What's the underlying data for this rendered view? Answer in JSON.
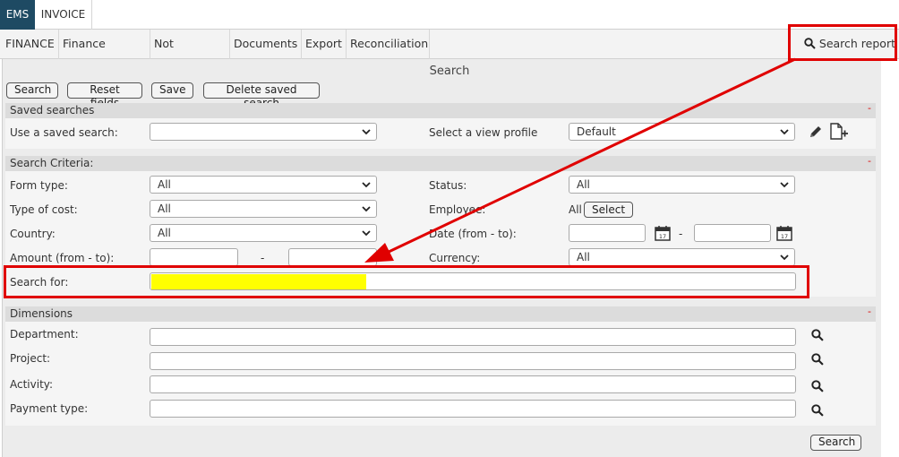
{
  "tabs": {
    "active": "EMS",
    "inactive": "INVOICE"
  },
  "nav": {
    "items": [
      "FINANCE",
      "Finance control",
      "Not matched",
      "Documents",
      "Export",
      "Reconciliation"
    ],
    "search_report": "Search report"
  },
  "page": {
    "title": "Search"
  },
  "toolbar": {
    "search": "Search",
    "reset": "Reset fields",
    "save": "Save",
    "delete": "Delete saved search"
  },
  "saved_searches": {
    "header": "Saved searches",
    "collapse": "-",
    "use_label": "Use a saved search:",
    "use_value": "",
    "profile_label": "Select a view profile",
    "profile_value": "Default"
  },
  "criteria": {
    "header": "Search Criteria:",
    "collapse": "-",
    "form_type_label": "Form type:",
    "form_type_value": "All",
    "status_label": "Status:",
    "status_value": "All",
    "cost_label": "Type of cost:",
    "cost_value": "All",
    "employee_label": "Employee:",
    "employee_value": "All",
    "employee_button": "Select",
    "country_label": "Country:",
    "country_value": "All",
    "date_label": "Date (from - to):",
    "date_sep": "-",
    "amount_label": "Amount (from - to):",
    "amount_sep": "-",
    "currency_label": "Currency:",
    "currency_value": "All",
    "search_for_label": "Search for:"
  },
  "dimensions": {
    "header": "Dimensions",
    "collapse": "-",
    "department_label": "Department:",
    "project_label": "Project:",
    "activity_label": "Activity:",
    "payment_label": "Payment type:"
  },
  "footer": {
    "search": "Search"
  },
  "colors": {
    "active_tab": "#1e4a63",
    "annotation": "#e00000",
    "highlight": "#ffff00"
  }
}
